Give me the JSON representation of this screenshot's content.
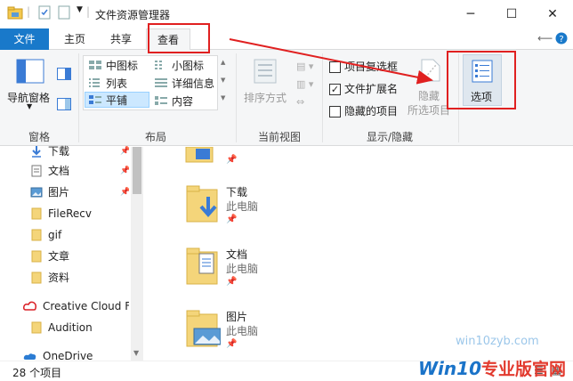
{
  "window": {
    "title": "文件资源管理器",
    "controls": {
      "minimize": "─",
      "maximize": "☐",
      "close": "✕"
    }
  },
  "tabs": [
    {
      "label": "文件"
    },
    {
      "label": "主页"
    },
    {
      "label": "共享"
    },
    {
      "label": "查看"
    }
  ],
  "ribbon": {
    "panes": {
      "nav_pane": "导航窗格",
      "group_label": "窗格"
    },
    "layout": {
      "items": [
        "中图标",
        "小图标",
        "列表",
        "详细信息",
        "平铺",
        "内容"
      ],
      "selected": "平铺",
      "group_label": "布局"
    },
    "current_view": {
      "sort": "排序方式",
      "group_label": "当前视图"
    },
    "show_hide": {
      "item_checkboxes": "项目复选框",
      "item_checkboxes_checked": false,
      "file_extensions": "文件扩展名",
      "file_extensions_checked": true,
      "hidden_items": "隐藏的项目",
      "hidden_items_checked": false,
      "hide_selected_line1": "隐藏",
      "hide_selected_line2": "所选项目",
      "group_label": "显示/隐藏"
    },
    "options": {
      "label": "选项"
    }
  },
  "nav": {
    "items": [
      {
        "label": "下载",
        "icon": "download-icon"
      },
      {
        "label": "文档",
        "icon": "document-icon"
      },
      {
        "label": "图片",
        "icon": "pictures-icon"
      },
      {
        "label": "FileRecv",
        "icon": "folder-icon"
      },
      {
        "label": "gif",
        "icon": "folder-icon"
      },
      {
        "label": "文章",
        "icon": "folder-icon"
      },
      {
        "label": "资料",
        "icon": "folder-icon"
      },
      {
        "label": "Creative Cloud Fil",
        "icon": "creative-cloud-icon"
      },
      {
        "label": "Audition",
        "icon": "folder-icon"
      },
      {
        "label": "OneDrive",
        "icon": "onedrive-icon"
      }
    ]
  },
  "main": {
    "items": [
      {
        "name": "下载",
        "location": "此电脑"
      },
      {
        "name": "文档",
        "location": "此电脑"
      },
      {
        "name": "图片",
        "location": "此电脑"
      }
    ]
  },
  "status": {
    "count": "28 个项目"
  },
  "watermark": {
    "url": "win10zyb.com",
    "brand": "Win10",
    "brand_cn": "专业版官网"
  }
}
